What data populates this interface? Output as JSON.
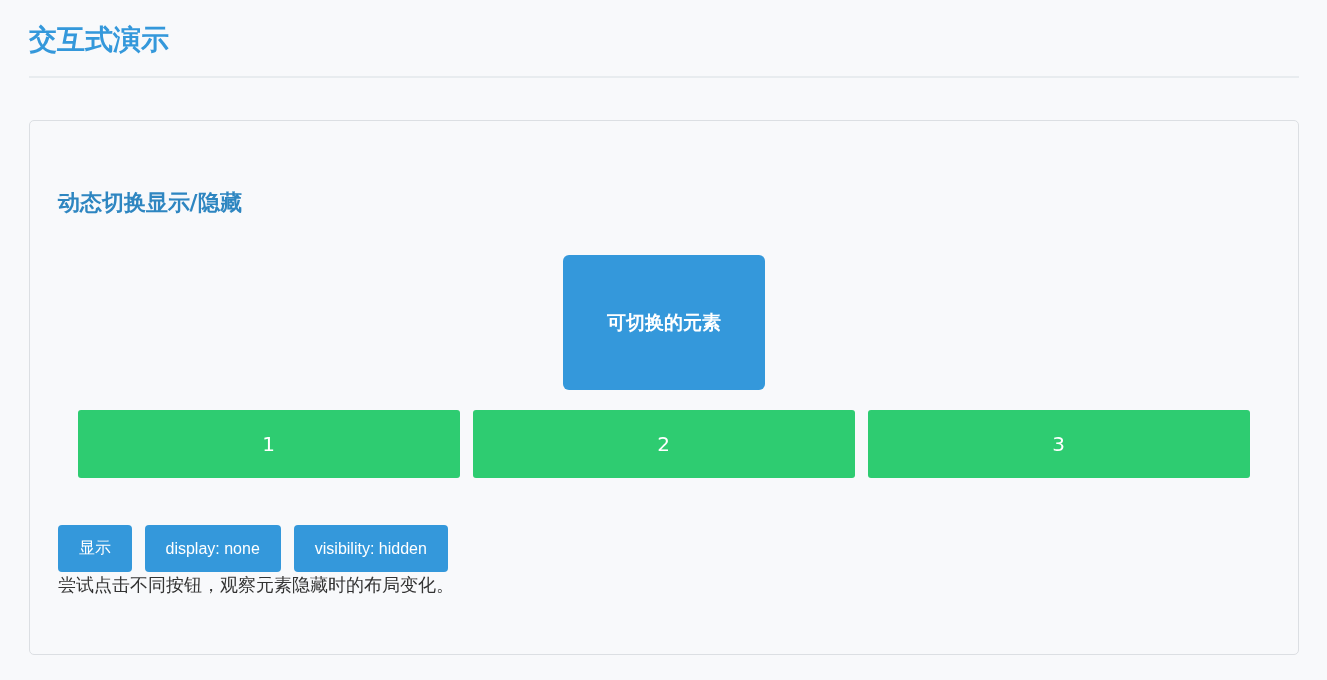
{
  "page": {
    "title": "交互式演示"
  },
  "demo": {
    "heading": "动态切换显示/隐藏",
    "toggle_element": {
      "label": "可切换的元素"
    },
    "boxes": [
      {
        "label": "1"
      },
      {
        "label": "2"
      },
      {
        "label": "3"
      }
    ],
    "buttons": [
      {
        "label": "显示"
      },
      {
        "label": "display: none"
      },
      {
        "label": "visibility: hidden"
      }
    ],
    "hint": "尝试点击不同按钮，观察元素隐藏时的布局变化。"
  }
}
